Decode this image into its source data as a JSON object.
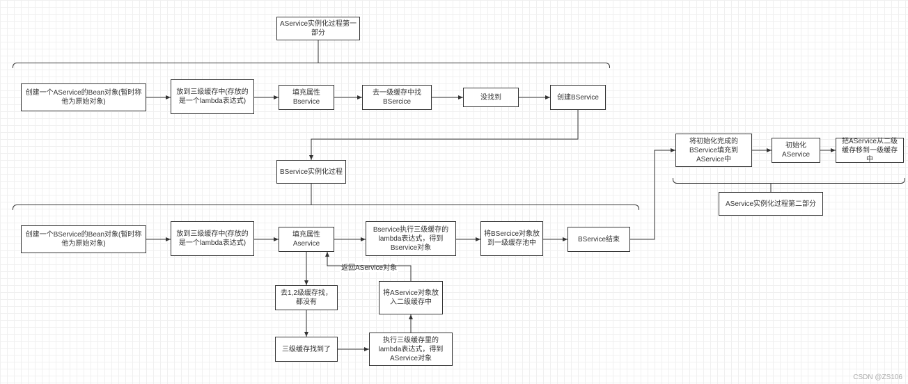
{
  "diagram": {
    "title1": "AService实例化过程第一部分",
    "row1": {
      "n1": "创建一个AService的Bean对象(暂时称他为原始对象)",
      "n2": "放到三级缓存中(存放的是一个lambda表达式)",
      "n3": "填充属性Bservice",
      "n4": "去一级缓存中找BSercice",
      "n5": "没找到",
      "n6": "创建BService"
    },
    "mid": {
      "bproc": "BService实例化过程"
    },
    "row2": {
      "n1": "创建一个BService的Bean对象(暂时称他为原始对象)",
      "n2": "放到三级缓存中(存放的是一个lambda表达式)",
      "n3": "填充属性Aservice",
      "n4": "Bservice执行三级缓存的lambda表达式，得到Bservice对象",
      "n5": "将BSercice对象放到一级缓存池中",
      "n6": "BService结束"
    },
    "sub": {
      "s1": "去1,2级缓存找，都没有",
      "s2": "三级缓存找到了",
      "s3": "执行三级缓存里的lambda表达式，得到AService对象",
      "s4": "将AService对象放入二级缓存中"
    },
    "edge1": "返回AService对象",
    "title2": "AService实例化过程第二部分",
    "row3": {
      "n1": "将初始化完成的BService填充到AService中",
      "n2": "初始化AService",
      "n3": "把AService从二级缓存移到一级缓存中"
    },
    "watermark": "CSDN @ZS106"
  }
}
